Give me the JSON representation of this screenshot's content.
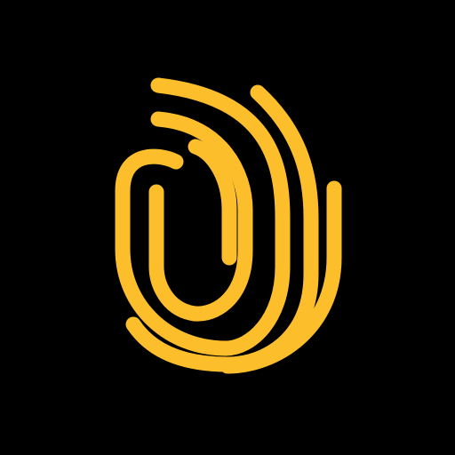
{
  "app_icon": {
    "icon_name": "fingerprint-icon",
    "background_color": "#000000",
    "accent_color": "#FDBE2C"
  }
}
